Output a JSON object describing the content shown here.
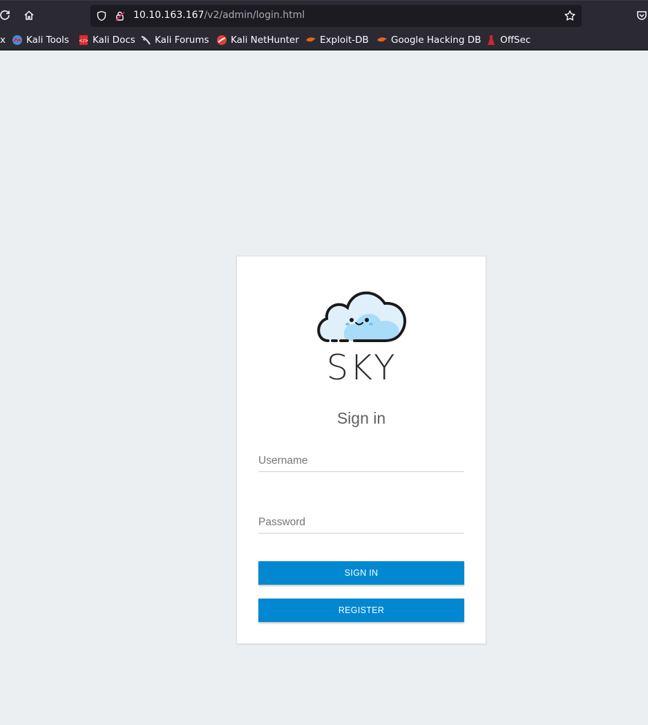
{
  "browser": {
    "url_host": "10.10.163.167",
    "url_path": "/v2/admin/login.html",
    "bookmarks": [
      {
        "label": "Kali Tools",
        "icon": "kali-tools-icon",
        "color": "#3d8fe0"
      },
      {
        "label": "Kali Docs",
        "icon": "kali-docs-icon",
        "color": "#e02b2b"
      },
      {
        "label": "Kali Forums",
        "icon": "kali-forums-icon",
        "color": "#dcdcdc"
      },
      {
        "label": "Kali NetHunter",
        "icon": "kali-nethunter-icon",
        "color": "#e0403a"
      },
      {
        "label": "Exploit-DB",
        "icon": "exploit-db-icon",
        "color": "#e8641d"
      },
      {
        "label": "Google Hacking DB",
        "icon": "ghdb-icon",
        "color": "#e8641d"
      },
      {
        "label": "OffSec",
        "icon": "offsec-icon",
        "color": "#d4242e"
      }
    ]
  },
  "login": {
    "brand": "SKY",
    "title": "Sign in",
    "username_placeholder": "Username",
    "password_placeholder": "Password",
    "signin_label": "SIGN IN",
    "register_label": "REGISTER",
    "accent_color": "#0288d1"
  }
}
